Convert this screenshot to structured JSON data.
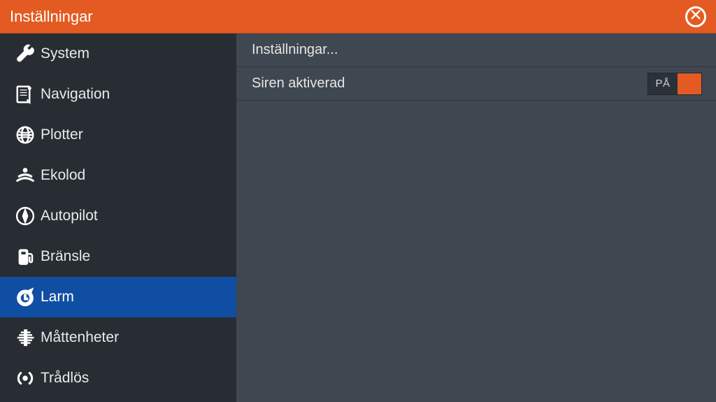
{
  "colors": {
    "accent": "#e35b22",
    "selected": "#0f4ea3",
    "panel": "#3f4751",
    "sidebar": "#272d33"
  },
  "header": {
    "title": "Inställningar"
  },
  "sidebar": {
    "items": [
      {
        "id": "system",
        "label": "System",
        "icon": "wrench-icon",
        "selected": false
      },
      {
        "id": "navigation",
        "label": "Navigation",
        "icon": "map-icon",
        "selected": false
      },
      {
        "id": "plotter",
        "label": "Plotter",
        "icon": "globe-icon",
        "selected": false
      },
      {
        "id": "ekolod",
        "label": "Ekolod",
        "icon": "sonar-icon",
        "selected": false
      },
      {
        "id": "autopilot",
        "label": "Autopilot",
        "icon": "compass-icon",
        "selected": false
      },
      {
        "id": "bransle",
        "label": "Bränsle",
        "icon": "fuel-icon",
        "selected": false
      },
      {
        "id": "larm",
        "label": "Larm",
        "icon": "alarm-icon",
        "selected": true
      },
      {
        "id": "mattenheter",
        "label": "Måttenheter",
        "icon": "ruler-icon",
        "selected": false
      },
      {
        "id": "tradlos",
        "label": "Trådlös",
        "icon": "wireless-icon",
        "selected": false
      }
    ]
  },
  "content": {
    "rows": [
      {
        "kind": "link",
        "label": "Inställningar..."
      },
      {
        "kind": "toggle",
        "label": "Siren aktiverad",
        "state": "PÅ",
        "on": true
      }
    ]
  }
}
